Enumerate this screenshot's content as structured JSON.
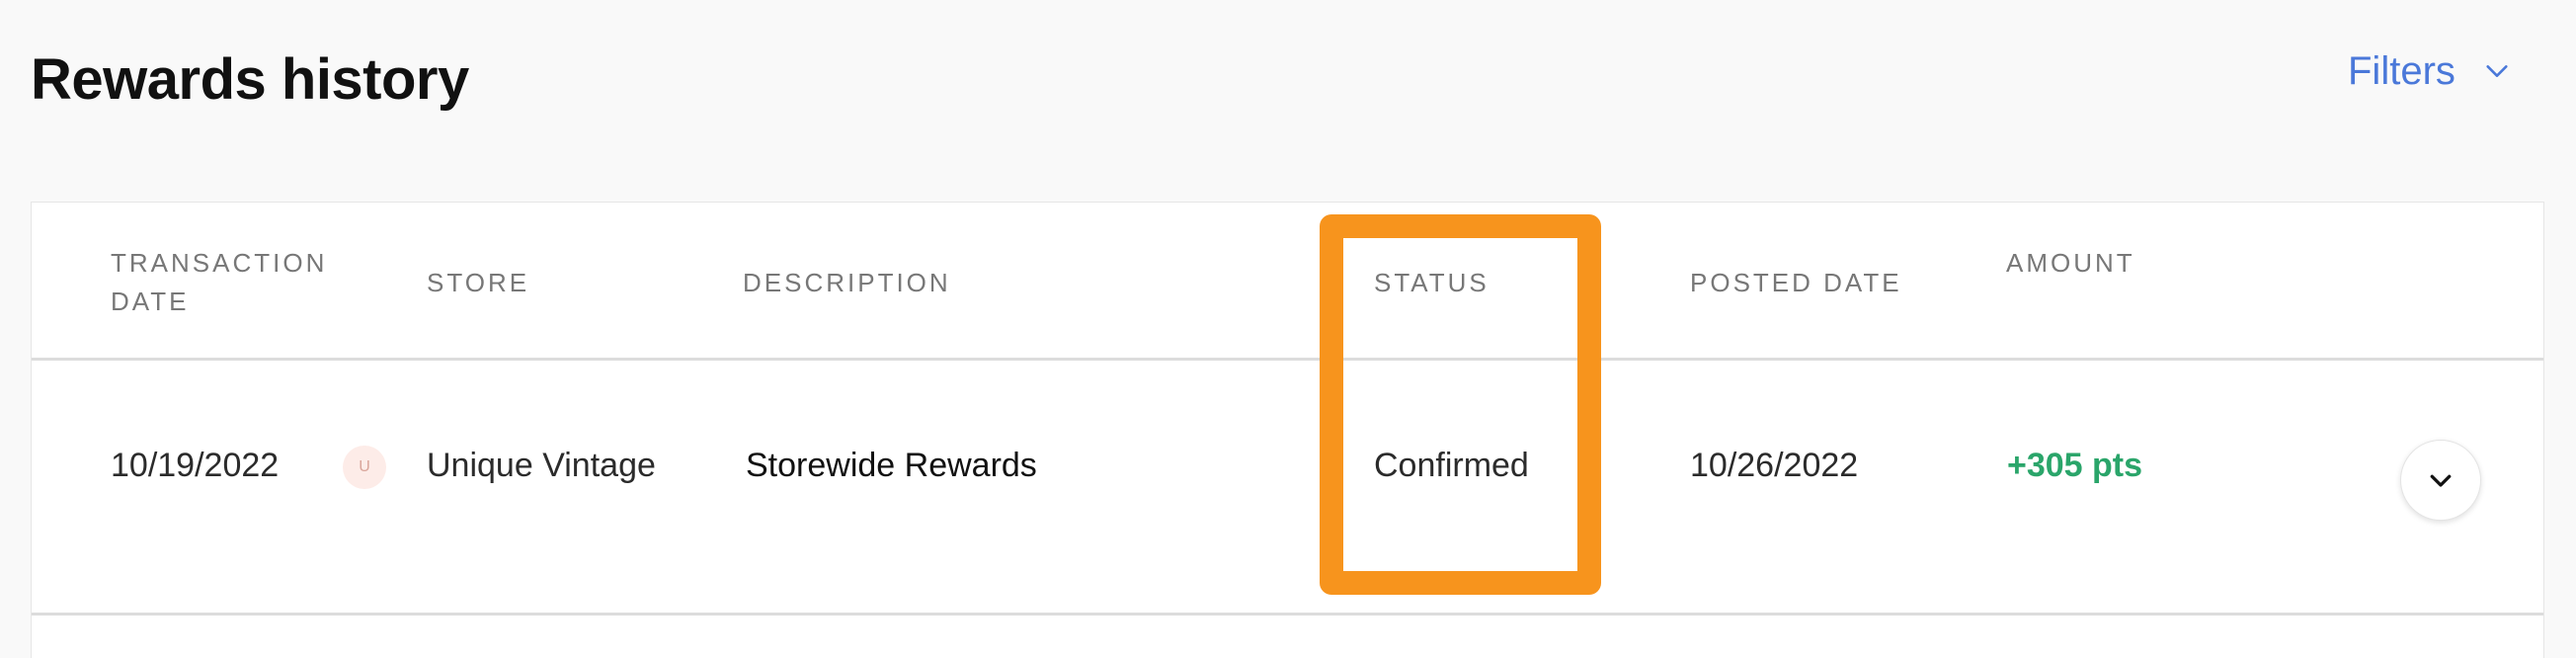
{
  "page": {
    "title": "Rewards history",
    "filters_label": "Filters"
  },
  "table": {
    "headers": {
      "transaction_date_line1": "TRANSACTION",
      "transaction_date_line2": "DATE",
      "store": "STORE",
      "description": "DESCRIPTION",
      "status": "STATUS",
      "posted_date": "POSTED DATE",
      "amount": "AMOUNT"
    },
    "rows": [
      {
        "transaction_date": "10/19/2022",
        "store_logo_letter": "U",
        "store": "Unique Vintage",
        "description": "Storewide Rewards",
        "status": "Confirmed",
        "posted_date": "10/26/2022",
        "amount": "+305 pts"
      }
    ]
  },
  "colors": {
    "accent": "#4a78d9",
    "highlight": "#f7941d",
    "positive": "#2aa56a"
  },
  "icons": {
    "filters": "chevron-down-icon",
    "expand": "chevron-down-icon"
  }
}
